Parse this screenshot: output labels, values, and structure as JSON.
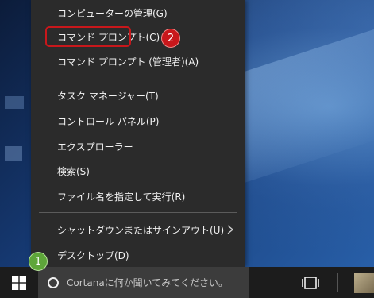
{
  "menu": {
    "items": [
      {
        "label": "コンピューターの管理(G)"
      },
      {
        "label": "コマンド プロンプト(C)"
      },
      {
        "label": "コマンド プロンプト (管理者)(A)"
      },
      {
        "label": "タスク マネージャー(T)"
      },
      {
        "label": "コントロール パネル(P)"
      },
      {
        "label": "エクスプローラー"
      },
      {
        "label": "検索(S)"
      },
      {
        "label": "ファイル名を指定して実行(R)"
      },
      {
        "label": "シャットダウンまたはサインアウト(U)"
      },
      {
        "label": "デスクトップ(D)"
      }
    ]
  },
  "annotations": {
    "step1": "1",
    "step2": "2",
    "highlight_color": "#c8171b",
    "step1_color": "#5ea63a"
  },
  "taskbar": {
    "search_placeholder": "Cortanaに何か聞いてみてください。"
  },
  "icons": {
    "start": "windows-logo-icon",
    "cortana": "cortana-circle-icon",
    "task_view": "task-view-icon",
    "submenu": "chevron-right-icon"
  }
}
